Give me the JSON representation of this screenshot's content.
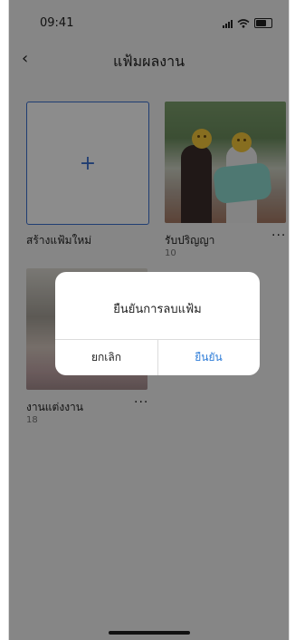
{
  "status_bar": {
    "time": "09:41"
  },
  "nav": {
    "back_icon": "chevron-left-icon",
    "title": "แฟ้มผลงาน"
  },
  "albums": {
    "new_label": "สร้างแฟ้มใหม่",
    "items": [
      {
        "name": "รับปริญญา",
        "count": "10",
        "more": "···"
      },
      {
        "name": "งานแต่งงาน",
        "count": "18",
        "more": "···"
      }
    ]
  },
  "dialog": {
    "message": "ยืนยันการลบแฟ้ม",
    "cancel_label": "ยกเลิก",
    "confirm_label": "ยืนยัน"
  },
  "colors": {
    "accent": "#3a6fd0",
    "confirm": "#2f7dd8"
  }
}
